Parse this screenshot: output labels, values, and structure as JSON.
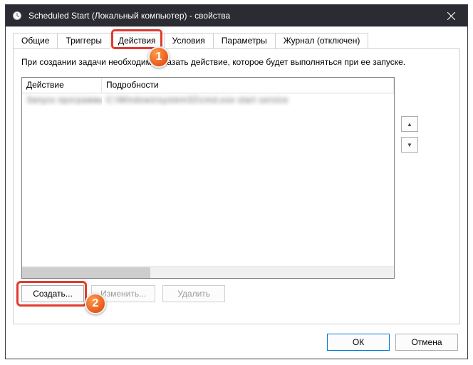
{
  "window": {
    "title": "Scheduled Start (Локальный компьютер) - свойства"
  },
  "tabs": {
    "general": "Общие",
    "triggers": "Триггеры",
    "actions": "Действия",
    "conditions": "Условия",
    "settings": "Параметры",
    "history": "Журнал (отключен)",
    "active": "actions"
  },
  "instruction": "При создании задачи необходимо указать действие, которое будет выполняться при ее запуске.",
  "list": {
    "columns": {
      "action": "Действие",
      "details": "Подробности"
    },
    "rows": [
      {
        "action": "Запуск программы",
        "details": "C:\\Windows\\system32\\cmd.exe start service"
      }
    ]
  },
  "spin": {
    "up": "▲",
    "down": "▼"
  },
  "buttons": {
    "create": "Создать...",
    "edit": "Изменить...",
    "delete": "Удалить"
  },
  "dialog": {
    "ok": "ОК",
    "cancel": "Отмена"
  },
  "annotations": {
    "badge1": "1",
    "badge2": "2"
  }
}
